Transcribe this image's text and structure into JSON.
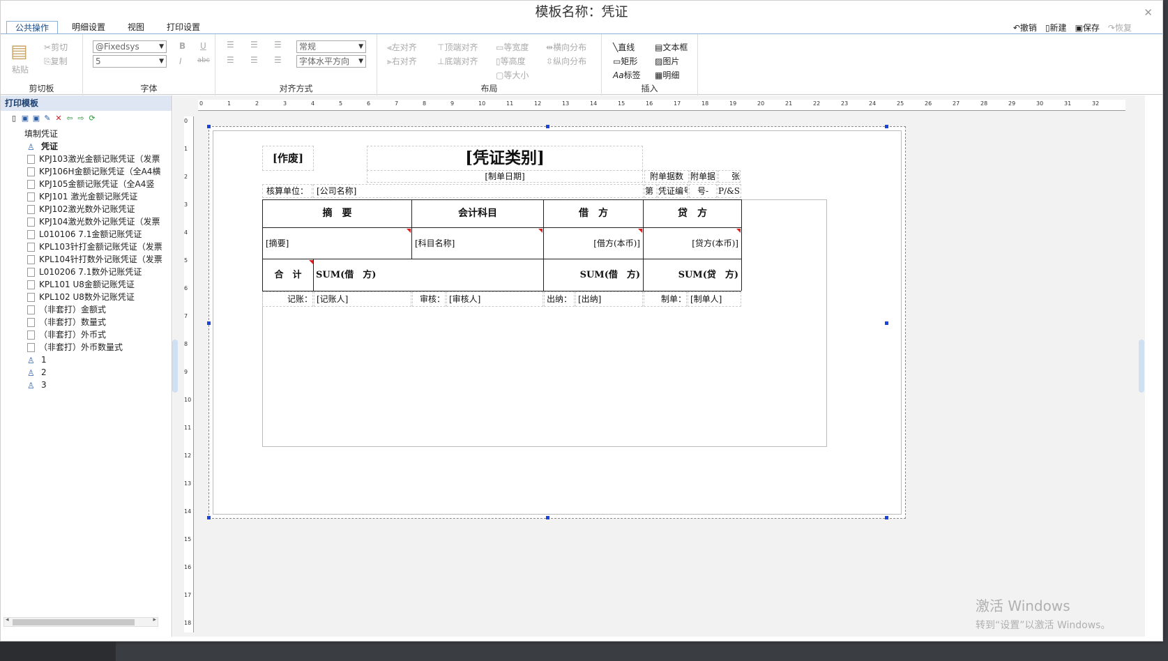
{
  "window": {
    "title": "模板名称：凭证",
    "close_label": "✕"
  },
  "tabs": [
    "公共操作",
    "明细设置",
    "视图",
    "打印设置"
  ],
  "quick_actions": [
    {
      "label": "撤销",
      "icon": "undo-icon",
      "enabled": true
    },
    {
      "label": "新建",
      "icon": "new-icon",
      "enabled": true
    },
    {
      "label": "保存",
      "icon": "save-icon",
      "enabled": true
    },
    {
      "label": "恢复",
      "icon": "redo-icon",
      "enabled": false
    }
  ],
  "ribbon": {
    "clipboard": {
      "label": "剪切板",
      "paste": "粘贴",
      "cut": "剪切",
      "copy": "复制"
    },
    "font": {
      "label": "字体",
      "family": "@Fixedsys",
      "size": "5",
      "bold": "B",
      "underline": "U",
      "italic": "I",
      "strike": "abc"
    },
    "align": {
      "label": "对齐方式",
      "style": "常规",
      "direction": "字体水平方向"
    },
    "layout": {
      "label": "布局",
      "align_left": "左对齐",
      "align_right": "右对齐",
      "align_top": "顶端对齐",
      "align_bottom": "底端对齐",
      "same_width": "等宽度",
      "same_height": "等高度",
      "same_size": "等大小",
      "dist_h": "横向分布",
      "dist_v": "纵向分布"
    },
    "insert": {
      "label": "插入",
      "line": "直线",
      "textbox": "文本框",
      "rect": "矩形",
      "picture": "图片",
      "label_item": "标签",
      "detail": "明细"
    }
  },
  "left_panel": {
    "header": "打印模板",
    "root": "填制凭证",
    "items": [
      {
        "label": "凭证",
        "type": "user",
        "bold": true
      },
      {
        "label": "KPJ103激光金额记账凭证（发票",
        "type": "doc"
      },
      {
        "label": "KPJ106H金额记账凭证（全A4横",
        "type": "doc"
      },
      {
        "label": "KPJ105金额记账凭证（全A4竖",
        "type": "doc"
      },
      {
        "label": "KPJ101 激光金额记账凭证",
        "type": "doc"
      },
      {
        "label": "KPJ102激光数外记账凭证",
        "type": "doc"
      },
      {
        "label": "KPJ104激光数外记账凭证（发票",
        "type": "doc"
      },
      {
        "label": "L010106 7.1金额记账凭证",
        "type": "doc"
      },
      {
        "label": "KPL103针打金额记账凭证（发票",
        "type": "doc"
      },
      {
        "label": "KPL104针打数外记账凭证（发票",
        "type": "doc"
      },
      {
        "label": "L010206 7.1数外记账凭证",
        "type": "doc"
      },
      {
        "label": "KPL101 U8金额记账凭证",
        "type": "doc"
      },
      {
        "label": "KPL102 U8数外记账凭证",
        "type": "doc"
      },
      {
        "label": "（非套打）金额式",
        "type": "doc"
      },
      {
        "label": "（非套打）数量式",
        "type": "doc"
      },
      {
        "label": "（非套打）外币式",
        "type": "doc"
      },
      {
        "label": "（非套打）外币数量式",
        "type": "doc"
      },
      {
        "label": "1",
        "type": "user"
      },
      {
        "label": "2",
        "type": "user"
      },
      {
        "label": "3",
        "type": "user"
      }
    ]
  },
  "ruler": {
    "top": [
      "0",
      "1",
      "2",
      "3",
      "4",
      "5",
      "6",
      "7",
      "8",
      "9",
      "10",
      "11",
      "12",
      "13",
      "14",
      "15",
      "16",
      "17",
      "18",
      "19",
      "20",
      "21",
      "22",
      "23",
      "24",
      "25",
      "26",
      "27",
      "28",
      "29",
      "30",
      "31",
      "32"
    ],
    "left": [
      "0",
      "1",
      "2",
      "3",
      "4",
      "5",
      "6",
      "7",
      "8",
      "9",
      "10",
      "11",
      "12",
      "13",
      "14",
      "15",
      "16",
      "17",
      "18"
    ]
  },
  "voucher": {
    "void": "[作废]",
    "category": "[凭证类别]",
    "date": "[制单日期]",
    "attach_label": "附单据数",
    "attach_value": "附单据",
    "attach_unit": "张",
    "unit_label": "核算单位：",
    "company": "[公司名称]",
    "no_label": "第",
    "no_value": "凭证编号",
    "no_unit": "号-",
    "page": "P/&S",
    "headers": [
      "摘　要",
      "会计科目",
      "借　方",
      "贷　方"
    ],
    "row": [
      "[摘要]",
      "[科目名称]",
      "[借方(本币)]",
      "[贷方(本币)]"
    ],
    "total_label": "合　计",
    "total_text": "SUM(借　方)",
    "total_debit": "SUM(借　方)",
    "total_credit": "SUM(贷　方)",
    "footer": [
      {
        "label": "记账：",
        "value": "[记账人]"
      },
      {
        "label": "审核：",
        "value": "[审核人]"
      },
      {
        "label": "出纳：",
        "value": "[出纳]"
      },
      {
        "label": "制单：",
        "value": "[制单人]"
      }
    ]
  },
  "watermark": {
    "line1": "激活 Windows",
    "line2": "转到“设置”以激活 Windows。"
  }
}
